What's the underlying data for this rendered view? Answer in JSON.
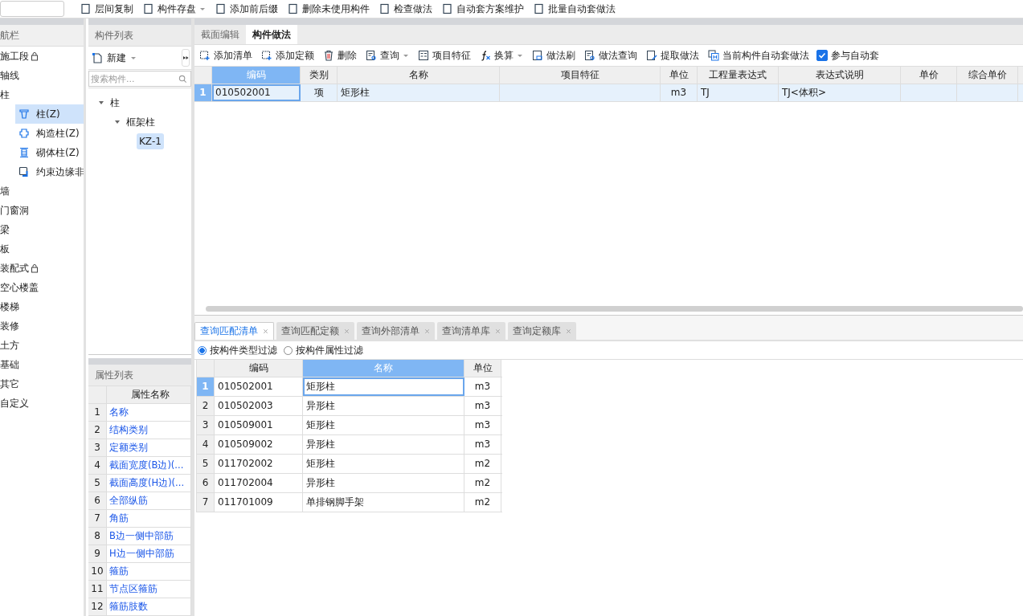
{
  "toolbar": [
    {
      "label": "层间复制",
      "dropdown": false
    },
    {
      "label": "构件存盘",
      "dropdown": true
    },
    {
      "label": "添加前后缀",
      "dropdown": false
    },
    {
      "label": "删除未使用构件",
      "dropdown": false
    },
    {
      "label": "检查做法",
      "dropdown": false
    },
    {
      "label": "自动套方案维护",
      "dropdown": false
    },
    {
      "label": "批量自动套做法",
      "dropdown": false
    }
  ],
  "nav": {
    "title": "航栏",
    "items": [
      {
        "label": "施工段",
        "locked": true,
        "selected": false
      },
      {
        "label": "轴线",
        "locked": false,
        "selected": false
      },
      {
        "label": "柱",
        "locked": false,
        "selected": false,
        "children": [
          {
            "label": "柱(Z)",
            "kind": "column",
            "selected": true
          },
          {
            "label": "构造柱(Z)",
            "kind": "structural",
            "selected": false
          },
          {
            "label": "砌体柱(Z)",
            "kind": "masonry",
            "selected": false
          },
          {
            "label": "约束边缘非",
            "kind": "edge",
            "selected": false
          }
        ]
      },
      {
        "label": "墙",
        "locked": false,
        "selected": false
      },
      {
        "label": "门窗洞",
        "locked": false,
        "selected": false
      },
      {
        "label": "梁",
        "locked": false,
        "selected": false
      },
      {
        "label": "板",
        "locked": false,
        "selected": false
      },
      {
        "label": "装配式",
        "locked": true,
        "selected": false
      },
      {
        "label": "空心楼盖",
        "locked": false,
        "selected": false
      },
      {
        "label": "楼梯",
        "locked": false,
        "selected": false
      },
      {
        "label": "装修",
        "locked": false,
        "selected": false
      },
      {
        "label": "土方",
        "locked": false,
        "selected": false
      },
      {
        "label": "基础",
        "locked": false,
        "selected": false
      },
      {
        "label": "其它",
        "locked": false,
        "selected": false
      },
      {
        "label": "自定义",
        "locked": false,
        "selected": false
      }
    ]
  },
  "component_list": {
    "title": "构件列表",
    "new_button": "新建",
    "search": {
      "placeholder": "搜索构件..."
    },
    "tree": [
      {
        "label": "柱",
        "expanded": true,
        "selected": false,
        "children": [
          {
            "label": "框架柱",
            "expanded": true,
            "selected": false,
            "children": [
              {
                "label": "KZ-1",
                "expanded": false,
                "selected": true
              }
            ]
          }
        ]
      }
    ]
  },
  "properties": {
    "title": "属性列表",
    "column": "属性名称",
    "rows": [
      {
        "index": "1",
        "name": "名称"
      },
      {
        "index": "2",
        "name": "结构类别"
      },
      {
        "index": "3",
        "name": "定额类别"
      },
      {
        "index": "4",
        "name": "截面宽度(B边)(..."
      },
      {
        "index": "5",
        "name": "截面高度(H边)(..."
      },
      {
        "index": "6",
        "name": "全部纵筋"
      },
      {
        "index": "7",
        "name": "角筋"
      },
      {
        "index": "8",
        "name": "B边一侧中部筋"
      },
      {
        "index": "9",
        "name": "H边一侧中部筋"
      },
      {
        "index": "10",
        "name": "箍筋"
      },
      {
        "index": "11",
        "name": "节点区箍筋"
      },
      {
        "index": "12",
        "name": "箍筋肢数"
      }
    ]
  },
  "main_tabs": [
    {
      "label": "截面编辑",
      "selected": false
    },
    {
      "label": "构件做法",
      "selected": true
    }
  ],
  "method_toolbar": [
    {
      "label": "添加清单",
      "kind": "add",
      "dropdown": false
    },
    {
      "label": "添加定额",
      "kind": "add",
      "dropdown": false
    },
    {
      "label": "删除",
      "kind": "delete",
      "dropdown": false
    },
    {
      "label": "查询",
      "kind": "query",
      "dropdown": true
    },
    {
      "label": "项目特征",
      "kind": "feature",
      "dropdown": false
    },
    {
      "label": "换算",
      "kind": "formula",
      "dropdown": true
    },
    {
      "label": "做法刷",
      "kind": "brush",
      "dropdown": false
    },
    {
      "label": "做法查询",
      "kind": "query",
      "dropdown": false
    },
    {
      "label": "提取做法",
      "kind": "extract",
      "dropdown": false
    },
    {
      "label": "当前构件自动套做法",
      "kind": "auto",
      "dropdown": false
    }
  ],
  "auto_participate": {
    "label": "参与自动套",
    "checked": true
  },
  "method_table": {
    "columns": [
      {
        "label": "编码",
        "selected": true
      },
      {
        "label": "类别",
        "selected": false
      },
      {
        "label": "名称",
        "selected": false
      },
      {
        "label": "项目特征",
        "selected": false
      },
      {
        "label": "单位",
        "selected": false
      },
      {
        "label": "工程量表达式",
        "selected": false
      },
      {
        "label": "表达式说明",
        "selected": false
      },
      {
        "label": "单价",
        "selected": false
      },
      {
        "label": "综合单价",
        "selected": false
      }
    ],
    "rows": [
      {
        "index": "1",
        "selected": true,
        "code": "010502001",
        "category": "项",
        "name": "矩形柱",
        "unit": "m3",
        "expression": "TJ",
        "expression_note": "TJ<体积>"
      }
    ]
  },
  "query_tabs": [
    {
      "label": "查询匹配清单",
      "selected": true
    },
    {
      "label": "查询匹配定额",
      "selected": false
    },
    {
      "label": "查询外部清单",
      "selected": false
    },
    {
      "label": "查询清单库",
      "selected": false
    },
    {
      "label": "查询定额库",
      "selected": false
    }
  ],
  "filters": [
    {
      "label": "按构件类型过滤",
      "selected": true
    },
    {
      "label": "按构件属性过滤",
      "selected": false
    }
  ],
  "query_table": {
    "columns": [
      {
        "label": "编码",
        "selected": false
      },
      {
        "label": "名称",
        "selected": true
      },
      {
        "label": "单位",
        "selected": false
      }
    ],
    "rows": [
      {
        "index": "1",
        "code": "010502001",
        "name": "矩形柱",
        "unit": "m3",
        "selected": true
      },
      {
        "index": "2",
        "code": "010502003",
        "name": "异形柱",
        "unit": "m3",
        "selected": false
      },
      {
        "index": "3",
        "code": "010509001",
        "name": "矩形柱",
        "unit": "m3",
        "selected": false
      },
      {
        "index": "4",
        "code": "010509002",
        "name": "异形柱",
        "unit": "m3",
        "selected": false
      },
      {
        "index": "5",
        "code": "011702002",
        "name": "矩形柱",
        "unit": "m2",
        "selected": false
      },
      {
        "index": "6",
        "code": "011702004",
        "name": "异形柱",
        "unit": "m2",
        "selected": false
      },
      {
        "index": "7",
        "code": "011701009",
        "name": "单排钢脚手架",
        "unit": "m2",
        "selected": false
      }
    ]
  }
}
